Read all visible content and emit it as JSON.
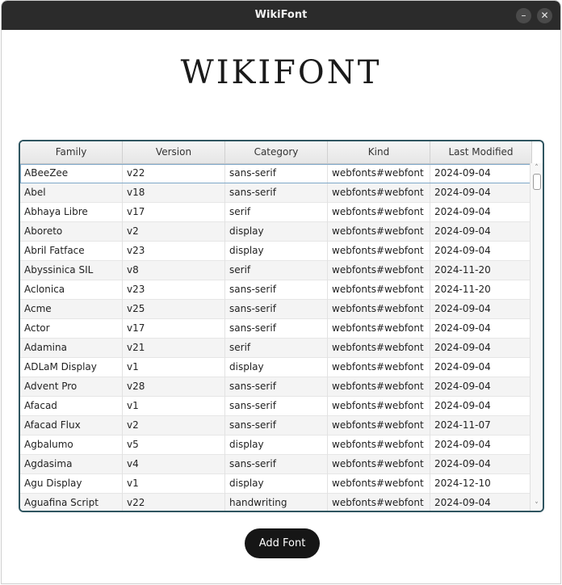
{
  "window": {
    "title": "WikiFont",
    "minimize_label": "–",
    "close_label": "✕"
  },
  "header": {
    "title": "WIKIFONT"
  },
  "table": {
    "columns": [
      "Family",
      "Version",
      "Category",
      "Kind",
      "Last Modified"
    ],
    "rows": [
      [
        "ABeeZee",
        "v22",
        "sans-serif",
        "webfonts#webfont",
        "2024-09-04"
      ],
      [
        "Abel",
        "v18",
        "sans-serif",
        "webfonts#webfont",
        "2024-09-04"
      ],
      [
        "Abhaya Libre",
        "v17",
        "serif",
        "webfonts#webfont",
        "2024-09-04"
      ],
      [
        "Aboreto",
        "v2",
        "display",
        "webfonts#webfont",
        "2024-09-04"
      ],
      [
        "Abril Fatface",
        "v23",
        "display",
        "webfonts#webfont",
        "2024-09-04"
      ],
      [
        "Abyssinica SIL",
        "v8",
        "serif",
        "webfonts#webfont",
        "2024-11-20"
      ],
      [
        "Aclonica",
        "v23",
        "sans-serif",
        "webfonts#webfont",
        "2024-11-20"
      ],
      [
        "Acme",
        "v25",
        "sans-serif",
        "webfonts#webfont",
        "2024-09-04"
      ],
      [
        "Actor",
        "v17",
        "sans-serif",
        "webfonts#webfont",
        "2024-09-04"
      ],
      [
        "Adamina",
        "v21",
        "serif",
        "webfonts#webfont",
        "2024-09-04"
      ],
      [
        "ADLaM Display",
        "v1",
        "display",
        "webfonts#webfont",
        "2024-09-04"
      ],
      [
        "Advent Pro",
        "v28",
        "sans-serif",
        "webfonts#webfont",
        "2024-09-04"
      ],
      [
        "Afacad",
        "v1",
        "sans-serif",
        "webfonts#webfont",
        "2024-09-04"
      ],
      [
        "Afacad Flux",
        "v2",
        "sans-serif",
        "webfonts#webfont",
        "2024-11-07"
      ],
      [
        "Agbalumo",
        "v5",
        "display",
        "webfonts#webfont",
        "2024-09-04"
      ],
      [
        "Agdasima",
        "v4",
        "sans-serif",
        "webfonts#webfont",
        "2024-09-04"
      ],
      [
        "Agu Display",
        "v1",
        "display",
        "webfonts#webfont",
        "2024-12-10"
      ],
      [
        "Aguafina Script",
        "v22",
        "handwriting",
        "webfonts#webfont",
        "2024-09-04"
      ]
    ]
  },
  "scrollbar": {
    "up_icon": "˄",
    "down_icon": "˅"
  },
  "actions": {
    "add_font_label": "Add Font"
  }
}
